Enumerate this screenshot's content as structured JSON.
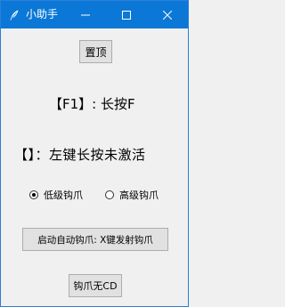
{
  "window": {
    "title": "小助手",
    "accent_color": "#0b78d7",
    "icons": {
      "app": "feather-icon",
      "minimize": "minimize-icon",
      "maximize": "maximize-icon",
      "close": "close-icon"
    }
  },
  "main": {
    "pin_button": "置顶",
    "f1_label": "【F1】: 长按F",
    "left_label": "【】：左键长按未激活",
    "radio": {
      "low": {
        "label": "低级钩爪",
        "checked": true
      },
      "high": {
        "label": "高级钩爪",
        "checked": false
      }
    },
    "auto_button": "启动自动钩爪: X键发射钩爪",
    "cd_button": "钩爪无CD"
  }
}
